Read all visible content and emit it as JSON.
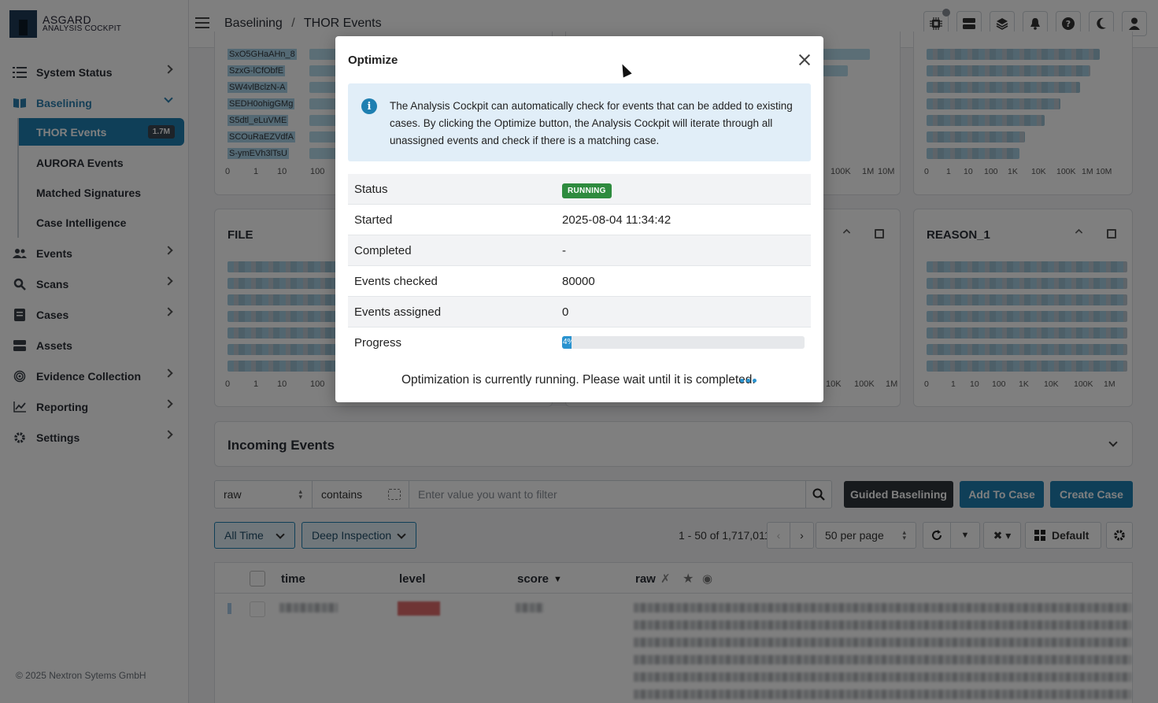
{
  "app": {
    "logo_line1": "ASGARD",
    "logo_line2": "ANALYSIS COCKPIT",
    "copyright": "© 2025 Nextron Sytems GmbH"
  },
  "sidebar": {
    "items": [
      {
        "label": "System Status",
        "icon": "list-icon"
      },
      {
        "label": "Baselining",
        "icon": "book-icon"
      },
      {
        "label": "Events",
        "icon": "users-icon"
      },
      {
        "label": "Scans",
        "icon": "search-icon"
      },
      {
        "label": "Cases",
        "icon": "cases-icon"
      },
      {
        "label": "Assets",
        "icon": "server-icon"
      },
      {
        "label": "Evidence Collection",
        "icon": "fingerprint-icon"
      },
      {
        "label": "Reporting",
        "icon": "chart-line-icon"
      },
      {
        "label": "Settings",
        "icon": "gear-icon"
      }
    ],
    "baselining_sub": [
      {
        "label": "THOR Events",
        "badge": "1.7M"
      },
      {
        "label": "AURORA Events"
      },
      {
        "label": "Matched Signatures"
      },
      {
        "label": "Case Intelligence"
      }
    ]
  },
  "header": {
    "breadcrumb": [
      "Baselining",
      "THOR Events"
    ]
  },
  "charts": {
    "top_left_labels": [
      "SxO5GHaAHn_8",
      "SzxG-lCfObfE",
      "SW4vlBclzN-A",
      "SEDH0ohigGMg",
      "S5dtl_eLuVME",
      "SCOuRaEZVdfA",
      "S-ymEVh3lTsU"
    ],
    "top_left_axis": [
      "0",
      "1",
      "10",
      "100"
    ],
    "top_mid_axis": [
      "100K",
      "1M",
      "10M"
    ],
    "top_right_axis": [
      "0",
      "1",
      "10",
      "100",
      "1K",
      "10K",
      "100K",
      "1M",
      "10M"
    ],
    "file_title": "FILE",
    "file_axis": [
      "0",
      "1",
      "10",
      "100"
    ],
    "mid_axis": [
      "10K",
      "100K",
      "1M"
    ],
    "reason_title": "REASON_1",
    "reason_axis": [
      "0",
      "1",
      "10",
      "100",
      "1K",
      "10K",
      "100K",
      "1M"
    ]
  },
  "incoming": {
    "title": "Incoming Events"
  },
  "filter": {
    "field": "raw",
    "operator": "contains",
    "placeholder": "Enter value you want to filter",
    "guided_label": "Guided Baselining",
    "add_case_label": "Add To Case",
    "create_case_label": "Create Case"
  },
  "toolbar": {
    "time_range": "All Time",
    "inspection": "Deep Inspection",
    "pagination": "1 - 50 of 1,717,011",
    "per_page": "50 per page",
    "view": "Default"
  },
  "table": {
    "columns": [
      "time",
      "level",
      "score",
      "raw"
    ]
  },
  "modal": {
    "title": "Optimize",
    "info": "The Analysis Cockpit can automatically check for events that can be added to existing cases. By clicking the Optimize button, the Analysis Cockpit will iterate through all unassigned events and check if there is a matching case.",
    "rows": [
      {
        "key": "Status",
        "value": "RUNNING"
      },
      {
        "key": "Started",
        "value": "2025-08-04 11:34:42"
      },
      {
        "key": "Completed",
        "value": "-"
      },
      {
        "key": "Events checked",
        "value": "80000"
      },
      {
        "key": "Events assigned",
        "value": "0"
      },
      {
        "key": "Progress",
        "value": "4%"
      }
    ],
    "progress_percent": 4,
    "running_message": "Optimization is currently running. Please wait until it is completed."
  },
  "colors": {
    "accent": "#1e7fb1",
    "status_running": "#2e8b3e",
    "guided_btn": "#2f353b"
  }
}
